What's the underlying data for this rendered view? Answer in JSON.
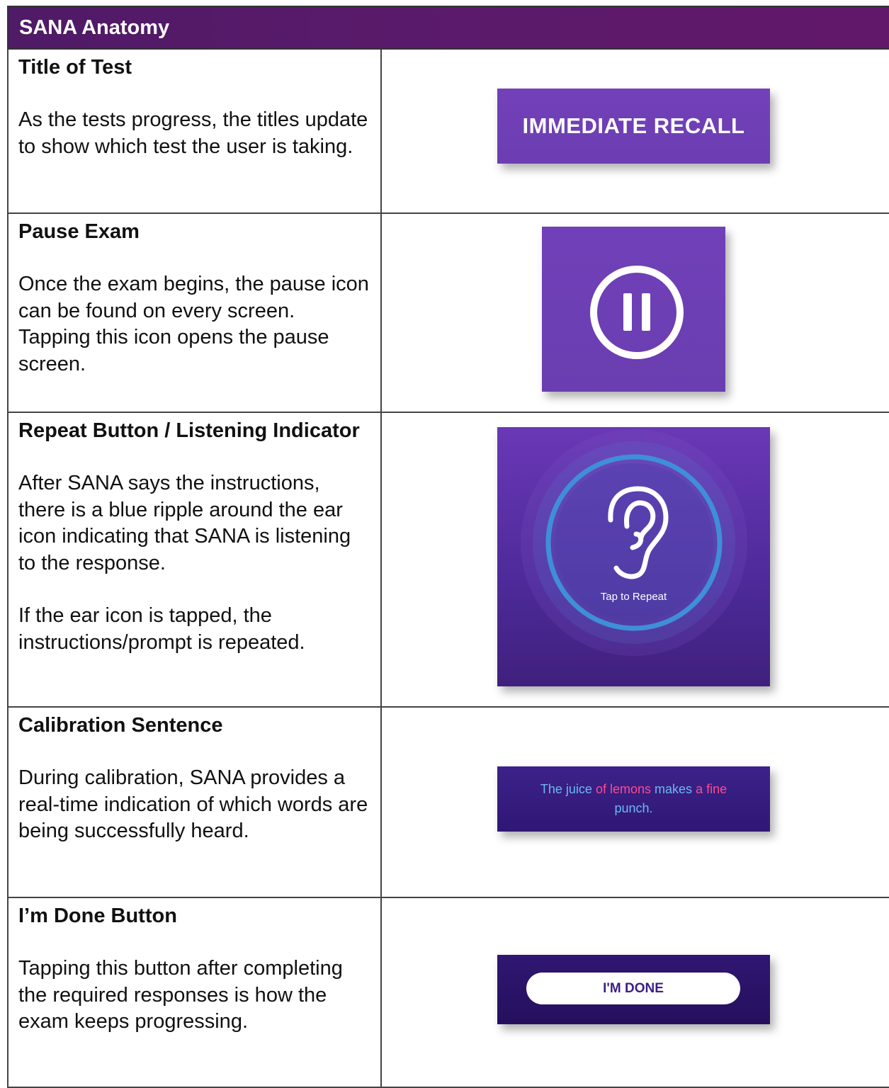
{
  "header": {
    "title": "SANA Anatomy"
  },
  "rows": [
    {
      "title": "Title of Test",
      "paragraphs": [
        "As the tests progress, the titles update to show which test the user is taking."
      ],
      "image": {
        "label": "IMMEDIATE RECALL",
        "bg_color": "#6f3fb6"
      }
    },
    {
      "title": "Pause Exam",
      "paragraphs": [
        "Once the exam begins, the pause icon can be found on every screen. Tapping this icon opens the pause screen."
      ],
      "image": {
        "icon": "pause-icon",
        "bg_color": "#6c3fb3"
      }
    },
    {
      "title": "Repeat Button / Listening Indicator",
      "paragraphs": [
        "After SANA says the instructions, there is a blue ripple around the ear icon indicating that SANA is listening to the response.",
        "If the ear icon is tapped, the instructions/prompt is repeated."
      ],
      "image": {
        "icon": "ear-icon",
        "label": "Tap to Repeat",
        "ripple_color": "#3f8fd8"
      }
    },
    {
      "title": "Calibration Sentence",
      "paragraphs": [
        "During calibration, SANA provides a real-time indication of which words are being successfully heard."
      ],
      "image": {
        "words": [
          {
            "text": "The",
            "state": "heard"
          },
          {
            "text": "juice",
            "state": "heard"
          },
          {
            "text": "of",
            "state": "not-heard"
          },
          {
            "text": "lemons",
            "state": "not-heard"
          },
          {
            "text": "makes",
            "state": "heard"
          },
          {
            "text": "a",
            "state": "not-heard"
          },
          {
            "text": "fine",
            "state": "not-heard"
          },
          {
            "text": "punch.",
            "state": "heard"
          }
        ],
        "heard_color": "#6bb9f0",
        "not_heard_color": "#ff4a8f"
      }
    },
    {
      "title": "I’m Done Button",
      "paragraphs": [
        "Tapping this button after completing the required responses is how the exam keeps progressing."
      ],
      "image": {
        "label": "I'M DONE",
        "bg_color": "#2a1366"
      }
    }
  ]
}
